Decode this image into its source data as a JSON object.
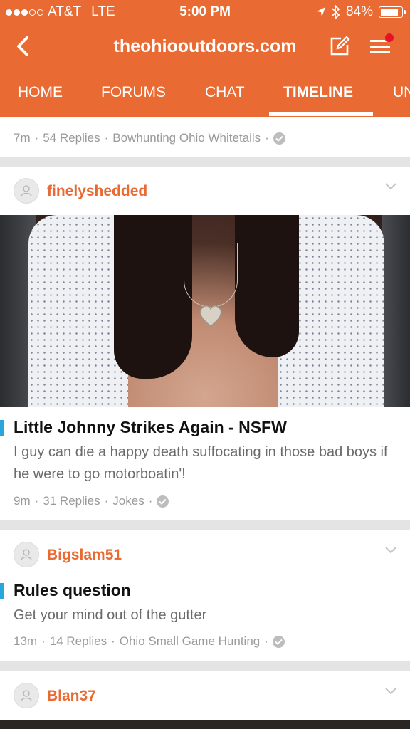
{
  "status": {
    "carrier": "AT&T",
    "network": "LTE",
    "time": "5:00 PM",
    "battery_pct": "84%",
    "signal_bars": 3,
    "battery_level": 0.84
  },
  "nav": {
    "site_title": "theohiooutdoors.com"
  },
  "tabs": [
    {
      "label": "HOME"
    },
    {
      "label": "FORUMS"
    },
    {
      "label": "CHAT"
    },
    {
      "label": "TIMELINE"
    },
    {
      "label": "UN"
    }
  ],
  "posts": [
    {
      "meta": {
        "age": "7m",
        "replies": "54 Replies",
        "forum": "Bowhunting Ohio Whitetails"
      }
    },
    {
      "username": "finelyshedded",
      "title": "Little Johnny Strikes Again - NSFW",
      "excerpt": "I guy can die a happy death suffocating in those bad boys if he were to go motorboatin'!",
      "meta": {
        "age": "9m",
        "replies": "31 Replies",
        "forum": "Jokes"
      }
    },
    {
      "username": "Bigslam51",
      "title": "Rules question",
      "excerpt": "Get your mind out of the gutter",
      "meta": {
        "age": "13m",
        "replies": "14 Replies",
        "forum": "Ohio Small Game Hunting"
      }
    },
    {
      "username": "Blan37"
    }
  ],
  "colors": {
    "brand": "#e96a32",
    "title_accent": "#2aa6dc",
    "notification": "#e8102a"
  }
}
